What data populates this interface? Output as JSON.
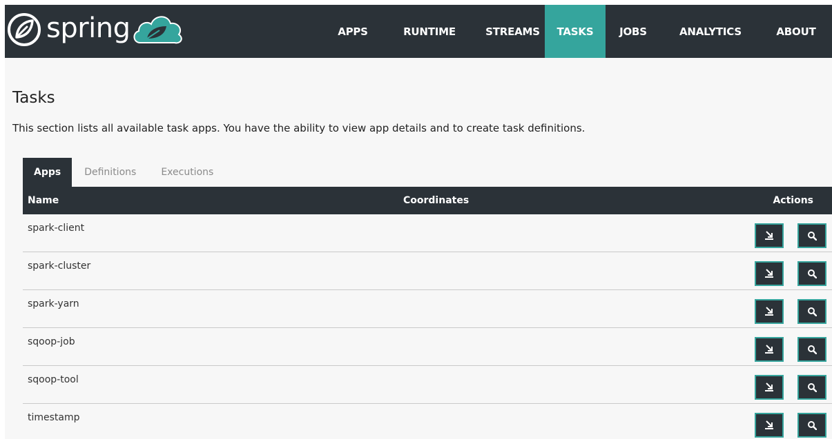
{
  "brand": {
    "name": "spring"
  },
  "nav": {
    "items": [
      {
        "label": "APPS"
      },
      {
        "label": "RUNTIME"
      },
      {
        "label": "STREAMS"
      },
      {
        "label": "TASKS",
        "active": true
      },
      {
        "label": "JOBS"
      },
      {
        "label": "ANALYTICS"
      },
      {
        "label": "ABOUT"
      }
    ]
  },
  "page": {
    "title": "Tasks",
    "description": "This section lists all available task apps. You have the ability to view app details and to create task definitions."
  },
  "tabs": [
    {
      "label": "Apps",
      "active": true
    },
    {
      "label": "Definitions"
    },
    {
      "label": "Executions"
    }
  ],
  "table": {
    "columns": {
      "name": "Name",
      "coordinates": "Coordinates",
      "actions": "Actions"
    },
    "rows": [
      {
        "name": "spark-client"
      },
      {
        "name": "spark-cluster"
      },
      {
        "name": "spark-yarn"
      },
      {
        "name": "sqoop-job"
      },
      {
        "name": "sqoop-tool"
      },
      {
        "name": "timestamp"
      }
    ]
  },
  "icons": {
    "create": "create-definition-icon",
    "details": "search-icon"
  },
  "colors": {
    "navbar": "#2b3238",
    "accent": "#35a59d",
    "background": "#f7f7f7"
  }
}
